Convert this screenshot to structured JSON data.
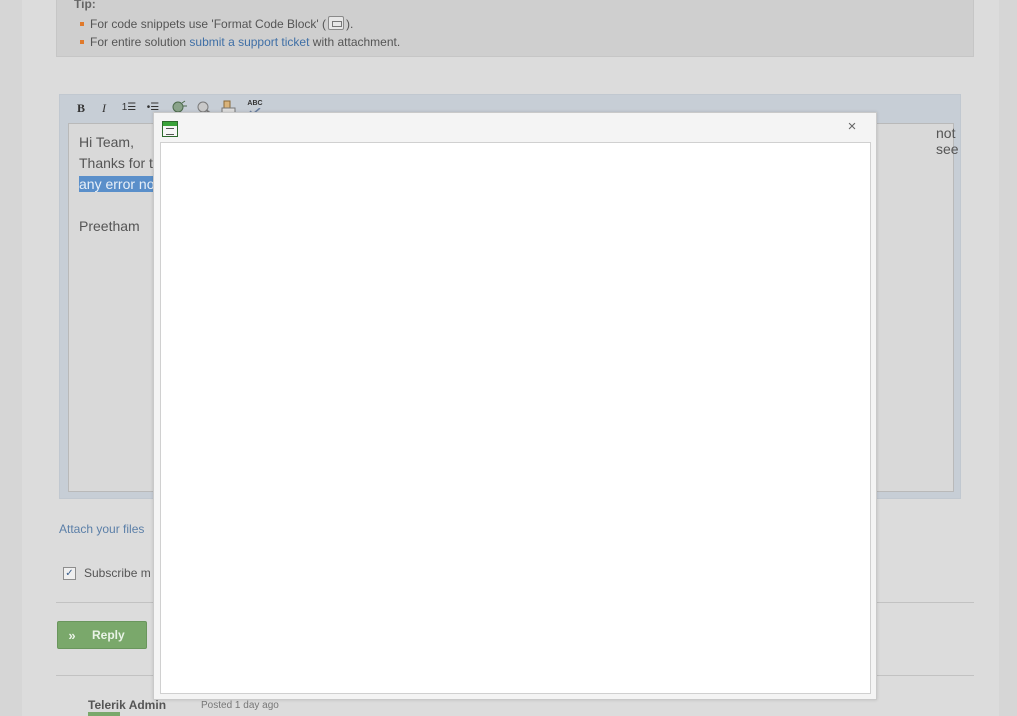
{
  "tip": {
    "title": "Tip:",
    "line1_prefix": "For code snippets use 'Format Code Block' (",
    "line1_suffix": ").",
    "line2_prefix": "For entire solution",
    "line2_link": "submit a support ticket",
    "line2_suffix": "with attachment."
  },
  "toolbar": {
    "bold": "B",
    "italic": "I",
    "ordered_list": "1☰",
    "unordered_list": "•☰",
    "spellcheck": "ABC"
  },
  "editor": {
    "line1": "Hi Team,",
    "line2": "Thanks for t",
    "line2_tail": "not see",
    "line3_selected": "any error no",
    "line4": "",
    "line5": "Preetham"
  },
  "attach_label": "Attach your files",
  "subscribe": {
    "label": "Subscribe m",
    "checked": true
  },
  "reply": {
    "label": "Reply",
    "icon": "double-chevron-right-icon"
  },
  "post": {
    "author": "Telerik Admin",
    "meta": "Posted 1 day ago"
  },
  "dialog": {
    "close_glyph": "×",
    "icon": "document-window-icon"
  },
  "colors": {
    "accent_link": "#3f6fa6",
    "selection": "#5a8fca",
    "reply_button": "#7aa86b",
    "bullet": "#e07a2c"
  }
}
